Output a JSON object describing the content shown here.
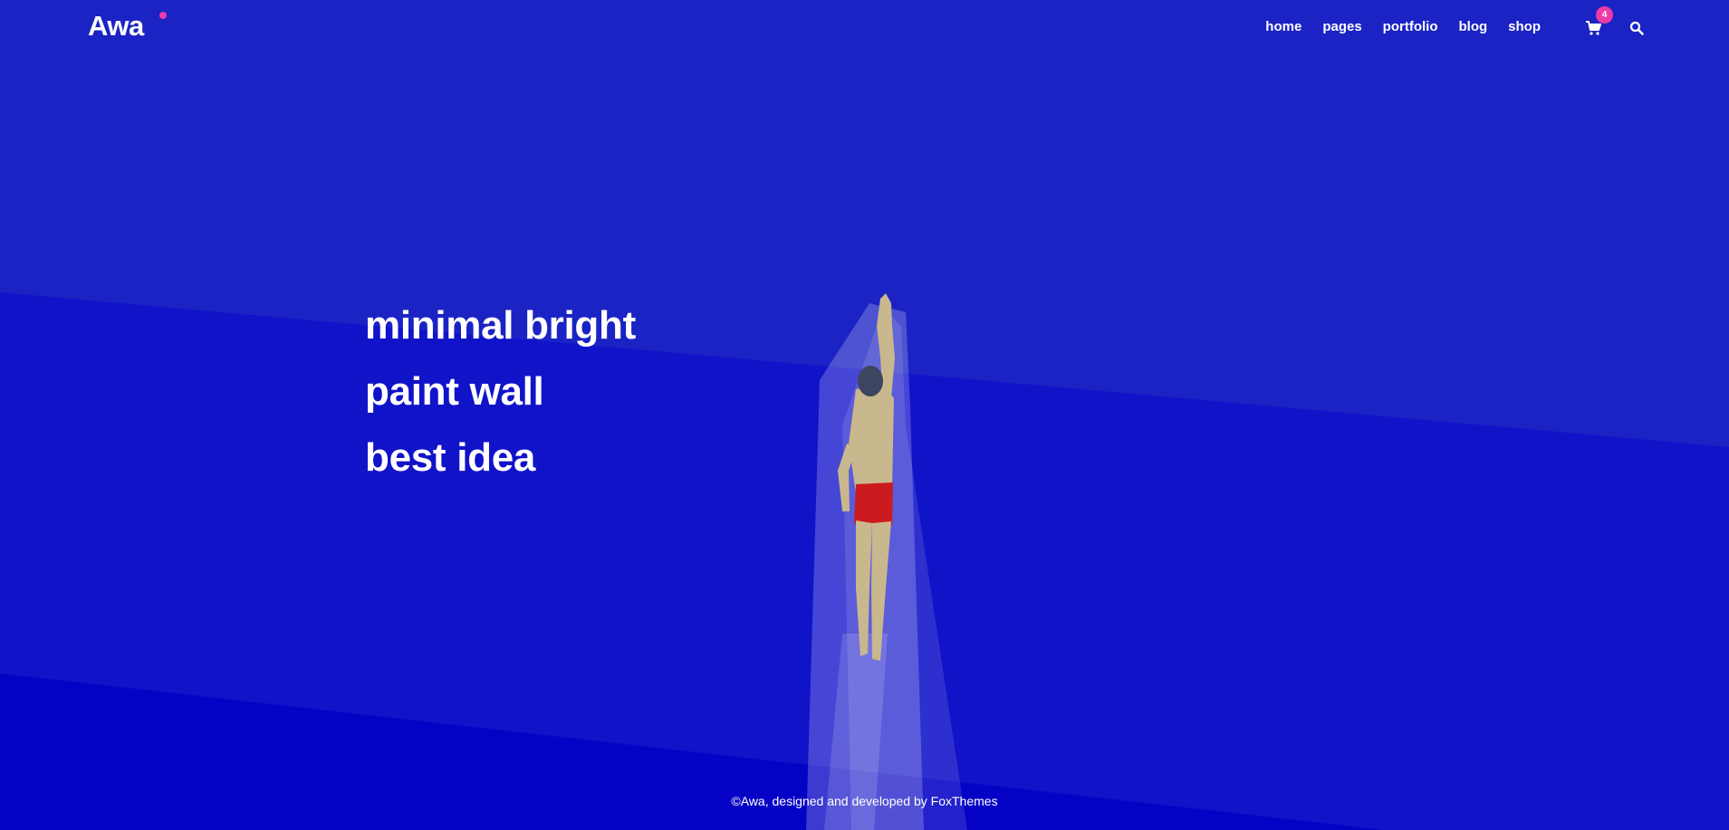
{
  "header": {
    "logo": "Awa",
    "nav": [
      "home",
      "pages",
      "portfolio",
      "blog",
      "shop"
    ],
    "cart_count": "4",
    "cart_icon": "cart-icon",
    "search_icon": "search-icon"
  },
  "hero": {
    "lines": [
      "minimal bright",
      "paint wall",
      "best idea"
    ]
  },
  "footer": {
    "prefix": "©Awa, designed and developed by ",
    "link": "FoxThemes"
  },
  "colors": {
    "background": "#1b23c4",
    "accent_pink": "#ee3aa9",
    "highlight_yellow": "#f5cf6d",
    "skin": "#c9b78d",
    "shorts": "#cc1b1f"
  }
}
